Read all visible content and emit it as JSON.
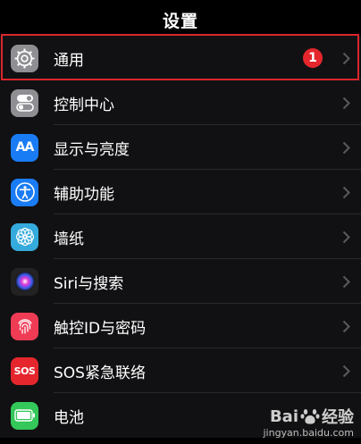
{
  "header": {
    "title": "设置"
  },
  "items": [
    {
      "label": "通用",
      "icon": "gear-icon",
      "color": "#8e8e93",
      "badge": "1"
    },
    {
      "label": "控制中心",
      "icon": "toggle-switches-icon",
      "color": "#8e8e93"
    },
    {
      "label": "显示与亮度",
      "icon": "text-size-icon",
      "color": "#1a7cf5",
      "icon_text": "AA"
    },
    {
      "label": "辅助功能",
      "icon": "accessibility-icon",
      "color": "#1a7cf5"
    },
    {
      "label": "墙纸",
      "icon": "flower-icon",
      "color": "#35aadc"
    },
    {
      "label": "Siri与搜索",
      "icon": "siri-icon",
      "color": "#222"
    },
    {
      "label": "触控ID与密码",
      "icon": "fingerprint-icon",
      "color": "#f03b55"
    },
    {
      "label": "SOS紧急联络",
      "icon": "sos-icon",
      "color": "#e5262d",
      "icon_text": "SOS"
    },
    {
      "label": "电池",
      "icon": "battery-icon",
      "color": "#34c759"
    }
  ],
  "watermark": {
    "brand_left": "Bai",
    "brand_right": "经验",
    "url": "jingyan.baidu.com"
  }
}
